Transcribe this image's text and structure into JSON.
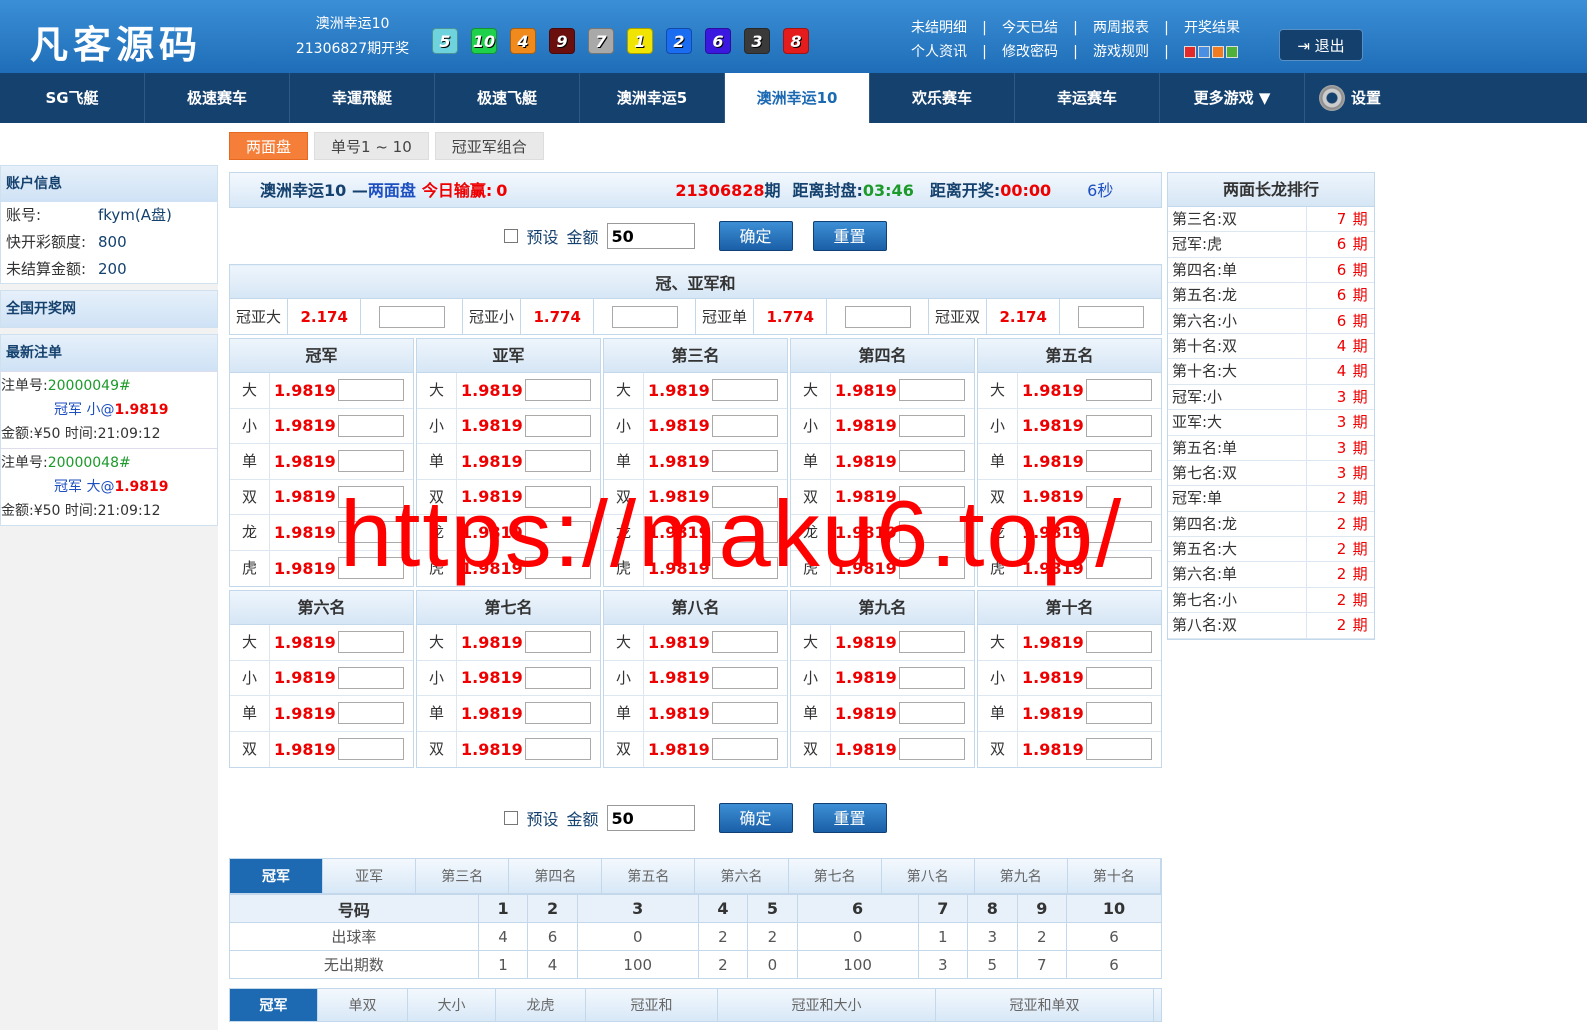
{
  "header": {
    "logo": "凡客源码",
    "draw_game": "澳洲幸运10",
    "draw_period": "21306827期开奖",
    "balls": [
      {
        "n": "5",
        "color": "#6ed3dc"
      },
      {
        "n": "10",
        "color": "#1fd04a"
      },
      {
        "n": "4",
        "color": "#f08a1c"
      },
      {
        "n": "9",
        "color": "#6b0e0e"
      },
      {
        "n": "7",
        "color": "#a9a9a9"
      },
      {
        "n": "1",
        "color": "#f0e400"
      },
      {
        "n": "2",
        "color": "#1a6cf0"
      },
      {
        "n": "6",
        "color": "#3a18e0"
      },
      {
        "n": "3",
        "color": "#3a3a3a"
      },
      {
        "n": "8",
        "color": "#e51c1c"
      }
    ],
    "links_row1": [
      "未结明细",
      "今天已结",
      "两周报表",
      "开奖结果"
    ],
    "links_row2": [
      "个人资讯",
      "修改密码",
      "游戏规则"
    ],
    "separator": "|",
    "swatches": [
      "#e32a2a",
      "#4a90e2",
      "#f07b20",
      "#4fb03a"
    ],
    "logout": "退出"
  },
  "nav": [
    "SG飞艇",
    "极速赛车",
    "幸運飛艇",
    "极速飞艇",
    "澳洲幸运5",
    "澳洲幸运10",
    "欢乐赛车",
    "幸运赛车",
    "更多游戏 ▼"
  ],
  "nav_settings": "设置",
  "subtabs": [
    "两面盘",
    "单号1 ~ 10",
    "冠亚军组合"
  ],
  "left": {
    "account_title": "账户信息",
    "account": [
      {
        "k": "账号:",
        "v": "fkym(A盘)"
      },
      {
        "k": "快开彩额度:",
        "v": "800"
      },
      {
        "k": "未结算金额:",
        "v": "200"
      }
    ],
    "national_title": "全国开奖网",
    "latest_title": "最新注单",
    "bets": [
      {
        "label": "注单号:",
        "no": "20000049#",
        "pos": "冠军",
        "pick": "小@",
        "odd": "1.9819",
        "amt": "金额:¥50",
        "time": "时间:21:09:12"
      },
      {
        "label": "注单号:",
        "no": "20000048#",
        "pos": "冠军",
        "pick": "大@",
        "odd": "1.9819",
        "amt": "金额:¥50",
        "time": "时间:21:09:12"
      }
    ]
  },
  "info": {
    "game": "澳洲幸运10 — ",
    "mode": "两面盘",
    "today_label": "今日输赢:",
    "today_value": "0",
    "period": "21306828",
    "period_suffix": "期",
    "close_label": "距离封盘:",
    "close_value": "03:46",
    "open_label": "距离开奖:",
    "open_value": "00:00",
    "refresh": "6秒"
  },
  "ctrl": {
    "preset": "预设",
    "amount_label": "金额",
    "amount": "50",
    "confirm": "确定",
    "reset": "重置"
  },
  "sum": {
    "title": "冠、亚军和",
    "items": [
      {
        "label": "冠亚大",
        "odd": "2.174"
      },
      {
        "label": "冠亚小",
        "odd": "1.774"
      },
      {
        "label": "冠亚单",
        "odd": "1.774"
      },
      {
        "label": "冠亚双",
        "odd": "2.174"
      }
    ]
  },
  "odd": "1.9819",
  "grid1": {
    "cols": [
      "冠军",
      "亚军",
      "第三名",
      "第四名",
      "第五名"
    ],
    "rows": [
      "大",
      "小",
      "单",
      "双",
      "龙",
      "虎"
    ]
  },
  "grid2": {
    "cols": [
      "第六名",
      "第七名",
      "第八名",
      "第九名",
      "第十名"
    ],
    "rows": [
      "大",
      "小",
      "单",
      "双"
    ]
  },
  "stats": {
    "tabs": [
      "冠军",
      "亚军",
      "第三名",
      "第四名",
      "第五名",
      "第六名",
      "第七名",
      "第八名",
      "第九名",
      "第十名"
    ],
    "head_label": "号码",
    "numbers": [
      "1",
      "2",
      "3",
      "4",
      "5",
      "6",
      "7",
      "8",
      "9",
      "10"
    ],
    "rows": [
      {
        "label": "出球率",
        "vals": [
          "4",
          "6",
          "0",
          "2",
          "2",
          "0",
          "1",
          "3",
          "2",
          "6"
        ]
      },
      {
        "label": "无出期数",
        "vals": [
          "1",
          "4",
          "100",
          "2",
          "0",
          "100",
          "3",
          "5",
          "7",
          "6"
        ]
      }
    ],
    "tabs2": [
      "冠军",
      "单双",
      "大小",
      "龙虎",
      "冠亚和",
      "冠亚和大小",
      "冠亚和单双"
    ]
  },
  "ranking": {
    "title": "两面长龙排行",
    "unit": "期",
    "items": [
      {
        "n": "第三名:双",
        "c": "7"
      },
      {
        "n": "冠军:虎",
        "c": "6"
      },
      {
        "n": "第四名:单",
        "c": "6"
      },
      {
        "n": "第五名:龙",
        "c": "6"
      },
      {
        "n": "第六名:小",
        "c": "6"
      },
      {
        "n": "第十名:双",
        "c": "4"
      },
      {
        "n": "第十名:大",
        "c": "4"
      },
      {
        "n": "冠军:小",
        "c": "3"
      },
      {
        "n": "亚军:大",
        "c": "3"
      },
      {
        "n": "第五名:单",
        "c": "3"
      },
      {
        "n": "第七名:双",
        "c": "3"
      },
      {
        "n": "冠军:单",
        "c": "2"
      },
      {
        "n": "第四名:龙",
        "c": "2"
      },
      {
        "n": "第五名:大",
        "c": "2"
      },
      {
        "n": "第六名:单",
        "c": "2"
      },
      {
        "n": "第七名:小",
        "c": "2"
      },
      {
        "n": "第八名:双",
        "c": "2"
      }
    ]
  },
  "watermark": "https://maku6.top/"
}
